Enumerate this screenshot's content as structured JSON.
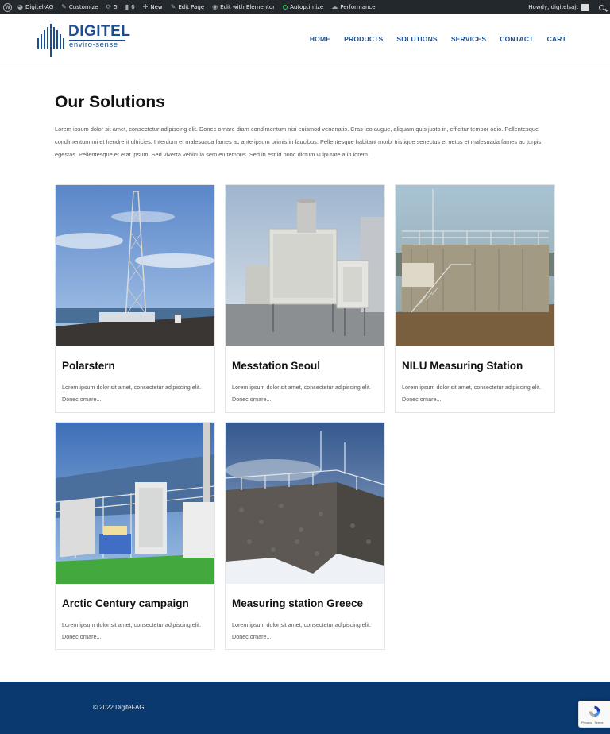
{
  "adminbar": {
    "site": "Digitel-AG",
    "customize": "Customize",
    "updates": "5",
    "comments": "0",
    "new": "New",
    "edit_page": "Edit Page",
    "elementor": "Edit with Elementor",
    "autoptimize": "Autoptimize",
    "performance": "Performance",
    "howdy": "Howdy, digitelsajt"
  },
  "logo": {
    "name": "DIGITEL",
    "tagline": "enviro-sense"
  },
  "nav": [
    "HOME",
    "PRODUCTS",
    "SOLUTIONS",
    "SERVICES",
    "CONTACT",
    "CART"
  ],
  "page": {
    "title": "Our Solutions",
    "intro": "Lorem ipsum dolor sit amet, consectetur adipiscing elit. Donec ornare diam condimentum nisi euismod venenatis. Cras leo augue, aliquam quis justo in, efficitur tempor odio. Pellentesque condimentum mi et hendrerit ultricies. Interdum et malesuada fames ac ante ipsum primis in faucibus. Pellentesque habitant morbi tristique senectus et netus et malesuada fames ac turpis egestas. Pellentesque et erat ipsum. Sed viverra vehicula sem eu tempus. Sed in est id nunc dictum vulputate a in lorem."
  },
  "cards": [
    {
      "title": "Polarstern",
      "excerpt": "Lorem ipsum dolor sit amet, consectetur adipiscing elit. Donec ornare..."
    },
    {
      "title": "Messtation Seoul",
      "excerpt": "Lorem ipsum dolor sit amet, consectetur adipiscing elit. Donec ornare..."
    },
    {
      "title": "NILU Measuring Station",
      "excerpt": "Lorem ipsum dolor sit amet, consectetur adipiscing elit. Donec ornare..."
    },
    {
      "title": "Arctic Century campaign",
      "excerpt": "Lorem ipsum dolor sit amet, consectetur adipiscing elit. Donec ornare..."
    },
    {
      "title": "Measuring station Greece",
      "excerpt": "Lorem ipsum dolor sit amet, consectetur adipiscing elit. Donec ornare..."
    }
  ],
  "footer": {
    "copyright": "© 2022 Digitel-AG"
  },
  "recaptcha": {
    "text": "Privacy - Terms"
  }
}
